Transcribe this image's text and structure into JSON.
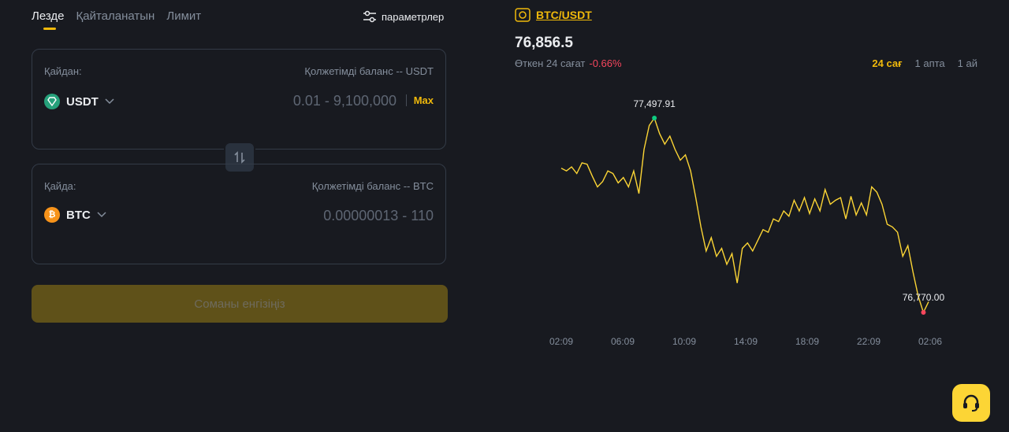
{
  "tabs": [
    "Лезде",
    "Қайталанатын",
    "Лимит"
  ],
  "params_label": "параметрлер",
  "from": {
    "label": "Қайдан:",
    "balance": "Қолжетімді баланс -- USDT",
    "coin": "USDT",
    "range": "0.01 - 9,100,000",
    "max": "Max"
  },
  "to": {
    "label": "Қайда:",
    "balance": "Қолжетімді баланс -- BTC",
    "coin": "BTC",
    "range": "0.00000013 - 110"
  },
  "submit_label": "Соманы енгізіңіз",
  "pair": "BTC/USDT",
  "price": "76,856.5",
  "change_label": "Өткен 24 сағат",
  "change_value": "-0.66%",
  "ranges": [
    "24 сағ",
    "1 апта",
    "1 ай"
  ],
  "colors": {
    "accent": "#f0b90b",
    "negative": "#f6465d",
    "positive": "#0ecb81",
    "line": "#fcd535"
  },
  "chart_data": {
    "type": "line",
    "x_ticks": [
      "02:09",
      "06:09",
      "10:09",
      "14:09",
      "18:09",
      "22:09",
      "02:06"
    ],
    "high_label": "77,497.91",
    "low_label": "76,770.00",
    "values": [
      77310,
      77300,
      77315,
      77290,
      77330,
      77325,
      77280,
      77240,
      77260,
      77300,
      77290,
      77255,
      77275,
      77240,
      77300,
      77215,
      77380,
      77470,
      77497.91,
      77440,
      77400,
      77430,
      77380,
      77340,
      77360,
      77300,
      77200,
      77090,
      77000,
      77050,
      76980,
      77010,
      76950,
      76990,
      76880,
      77010,
      77030,
      77000,
      77040,
      77080,
      77070,
      77120,
      77110,
      77150,
      77130,
      77190,
      77150,
      77200,
      77140,
      77195,
      77150,
      77230,
      77175,
      77190,
      77200,
      77120,
      77205,
      77135,
      77180,
      77135,
      77240,
      77220,
      77175,
      77100,
      77090,
      77070,
      76980,
      77020,
      76920,
      76830,
      76770,
      76810
    ]
  }
}
